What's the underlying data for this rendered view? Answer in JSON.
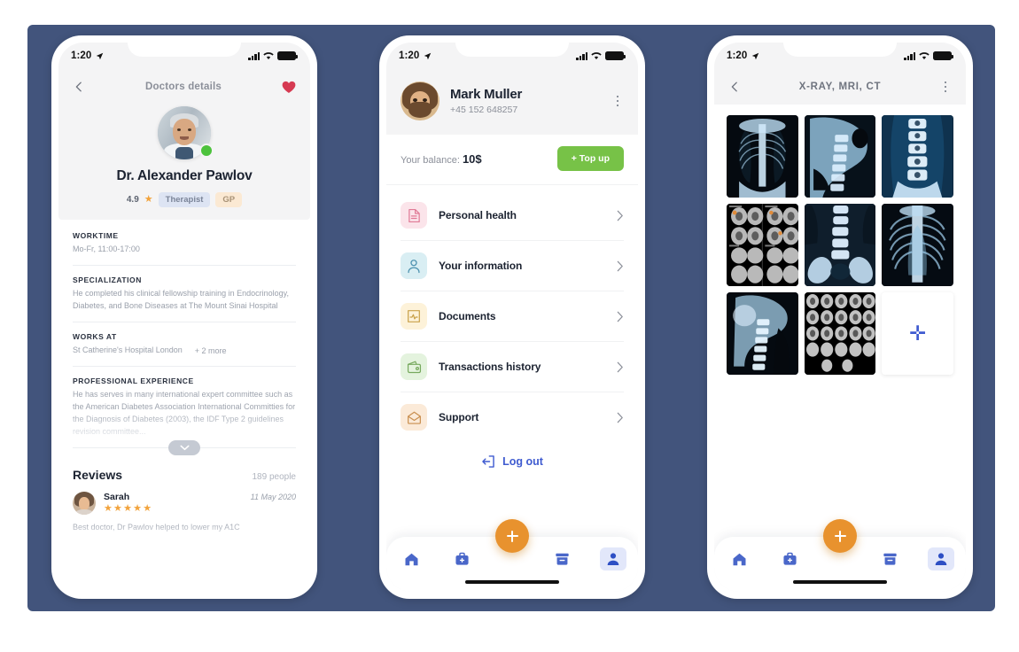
{
  "theme": {
    "backdrop": "#42547c",
    "accent_orange": "#e8922e",
    "accent_blue": "#3f5bd0",
    "green": "#77c247",
    "heart_red": "#d63a52"
  },
  "statusbar": {
    "time": "1:20",
    "location_icon": "location-arrow-icon",
    "signal_icon": "signal-bars-icon",
    "wifi_icon": "wifi-icon",
    "battery_icon": "battery-full-icon"
  },
  "phone1": {
    "nav": {
      "back_icon": "chevron-left-icon",
      "title": "Doctors details",
      "favorite_icon": "heart-filled-icon"
    },
    "doctor": {
      "avatar": "doctor-avatar",
      "online_status": "online",
      "name": "Dr. Alexander Pawlov",
      "rating": "4.9",
      "star_icon": "star-filled-icon",
      "tags": [
        {
          "label": "Therapist",
          "style": "blue"
        },
        {
          "label": "GP",
          "style": "peach"
        }
      ]
    },
    "sections": [
      {
        "label": "WORKTIME",
        "text": "Mo-Fr, 11:00-17:00"
      },
      {
        "label": "SPECIALIZATION",
        "text": "He completed his clinical fellowship training in Endocrinology, Diabetes, and Bone Diseases at The Mount Sinai Hospital"
      },
      {
        "label": "WORKS AT",
        "text": "St Catherine's Hospital London",
        "more": "+ 2 more"
      },
      {
        "label": "PROFESSIONAL EXPERIENCE",
        "text": "He has serves in many international expert committee such as the American Diabetes Association International Committies for the Diagnosis of Diabetes (2003), the IDF Type 2 guidelines revision committee..."
      }
    ],
    "expander_icon": "chevron-down-icon",
    "reviews": {
      "title": "Reviews",
      "count": "189 people",
      "items": [
        {
          "avatar": "reviewer-avatar",
          "name": "Sarah",
          "date": "11 May 2020",
          "stars": "★★★★★",
          "text": "Best doctor, Dr Pawlov helped to lower my A1C"
        }
      ]
    }
  },
  "phone2": {
    "profile": {
      "avatar": "user-avatar",
      "name": "Mark Muller",
      "phone": "+45 152 648257",
      "menu_icon": "kebab-menu-icon"
    },
    "balance": {
      "label": "Your balance:",
      "amount": "10$",
      "topup_label": "+ Top up"
    },
    "menu": [
      {
        "label": "Personal health",
        "icon": "health-document-icon",
        "bg": "#fbe4ea",
        "color": "#e07a96",
        "chevron": "chevron-right-icon"
      },
      {
        "label": "Your information",
        "icon": "person-icon",
        "bg": "#d9eef3",
        "color": "#4f93b0",
        "chevron": "chevron-right-icon"
      },
      {
        "label": "Documents",
        "icon": "chart-document-icon",
        "bg": "#fdf2d9",
        "color": "#c9a14a",
        "chevron": "chevron-right-icon"
      },
      {
        "label": "Transactions history",
        "icon": "wallet-icon",
        "bg": "#e4f3de",
        "color": "#77a95e",
        "chevron": "chevron-right-icon"
      },
      {
        "label": "Support",
        "icon": "mail-support-icon",
        "bg": "#fbead8",
        "color": "#c98f4f",
        "chevron": "chevron-right-icon"
      }
    ],
    "logout": {
      "icon": "logout-icon",
      "label": "Log out"
    }
  },
  "phone3": {
    "nav": {
      "back_icon": "chevron-left-icon",
      "title": "X-RAY, MRI, CT",
      "menu_icon": "kebab-menu-icon"
    },
    "gallery": [
      {
        "id": "xray-chest-front",
        "type": "xray"
      },
      {
        "id": "xray-cervical-spine-lateral",
        "type": "xray"
      },
      {
        "id": "xray-lumbar-spine-front",
        "type": "xray"
      },
      {
        "id": "mri-brain-slices-panel",
        "type": "mri"
      },
      {
        "id": "xray-lumbar-pelvis",
        "type": "xray"
      },
      {
        "id": "xray-chest-ribs",
        "type": "xray"
      },
      {
        "id": "xray-neck-skull-lateral",
        "type": "xray"
      },
      {
        "id": "mri-brain-grid",
        "type": "mri"
      },
      {
        "id": "add-image",
        "type": "add",
        "icon": "plus-icon"
      }
    ]
  },
  "tabbar": {
    "items": [
      {
        "name": "home",
        "icon": "home-icon",
        "active": false
      },
      {
        "name": "appointments",
        "icon": "medical-bag-icon",
        "active": false
      },
      {
        "name": "fab",
        "icon": "plus-icon",
        "active": false
      },
      {
        "name": "records",
        "icon": "archive-box-icon",
        "active": false
      },
      {
        "name": "profile",
        "icon": "person-filled-icon",
        "active": true
      }
    ]
  }
}
